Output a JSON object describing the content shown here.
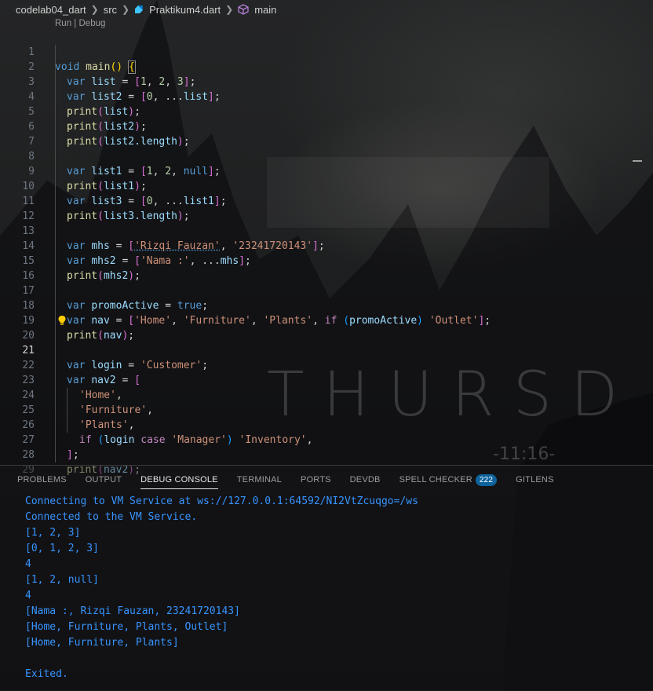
{
  "breadcrumb": {
    "items": [
      "codelab04_dart",
      "src",
      "Praktikum4.dart",
      "main"
    ]
  },
  "codelens": {
    "run": "Run",
    "sep": " | ",
    "debug": "Debug"
  },
  "editor": {
    "active_line": 21,
    "lines": [
      {
        "n": "1"
      },
      {
        "n": "2"
      },
      {
        "n": "3"
      },
      {
        "n": "4"
      },
      {
        "n": "5"
      },
      {
        "n": "6"
      },
      {
        "n": "7"
      },
      {
        "n": "8"
      },
      {
        "n": "9"
      },
      {
        "n": "10"
      },
      {
        "n": "11"
      },
      {
        "n": "12"
      },
      {
        "n": "13"
      },
      {
        "n": "14"
      },
      {
        "n": "15"
      },
      {
        "n": "16"
      },
      {
        "n": "17"
      },
      {
        "n": "18"
      },
      {
        "n": "19"
      },
      {
        "n": "20"
      },
      {
        "n": "21"
      },
      {
        "n": "22"
      },
      {
        "n": "23"
      },
      {
        "n": "24"
      },
      {
        "n": "25"
      },
      {
        "n": "26"
      },
      {
        "n": "27"
      },
      {
        "n": "28"
      },
      {
        "n": "29"
      }
    ],
    "tokens": {
      "void": "void",
      "main": "main",
      "parens": "()",
      "space": " ",
      "lbrace": "{",
      "var": "var",
      "list": "list",
      "list2": "list2",
      "list1": "list1",
      "list3": "list3",
      "eq": " = ",
      "lbr": "[",
      "rbr": "]",
      "semi": ";",
      "comma": ", ",
      "one": "1",
      "two": "2",
      "three": "3",
      "zero": "0",
      "spread": "...",
      "null": "null",
      "print": "print",
      "lp": "(",
      "rp": ")",
      "length": ".length",
      "mhs": "mhs",
      "mhs2": "mhs2",
      "str_rizqi": "'Rizqi Fauzan'",
      "str_nim": "'23241720143'",
      "str_nama": "'Nama :'",
      "promoActive": "promoActive",
      "true": "true",
      "nav": "nav",
      "nav2": "nav2",
      "str_home": "'Home'",
      "str_furniture": "'Furniture'",
      "str_plants": "'Plants'",
      "if": "if",
      "str_outlet": "'Outlet'",
      "login": "login",
      "str_customer": "'Customer'",
      "case": "case",
      "str_manager": "'Manager'",
      "str_inventory": "'Inventory'",
      "comma_only": ","
    }
  },
  "watermark": {
    "text": "THURSD",
    "time": "-11:16-"
  },
  "panel": {
    "tabs": [
      {
        "label": "PROBLEMS"
      },
      {
        "label": "OUTPUT"
      },
      {
        "label": "DEBUG CONSOLE"
      },
      {
        "label": "TERMINAL"
      },
      {
        "label": "PORTS"
      },
      {
        "label": "DEVDB"
      },
      {
        "label": "SPELL CHECKER",
        "badge": "222"
      },
      {
        "label": "GITLENS"
      }
    ],
    "active_tab": "DEBUG CONSOLE",
    "console": [
      "Connecting to VM Service at ws://127.0.0.1:64592/NI2VtZcuqgo=/ws",
      "Connected to the VM Service.",
      "[1, 2, 3]",
      "[0, 1, 2, 3]",
      "4",
      "[1, 2, null]",
      "4",
      "[Nama :, Rizqi Fauzan, 23241720143]",
      "[Home, Furniture, Plants, Outlet]",
      "[Home, Furniture, Plants]",
      "",
      "Exited."
    ]
  },
  "colors": {
    "keyword": "#569cd6",
    "function": "#dcdcaa",
    "variable": "#9cdcfe",
    "number": "#b5cea8",
    "string": "#ce9178",
    "console": "#3794ff",
    "badge": "#0e639c"
  }
}
